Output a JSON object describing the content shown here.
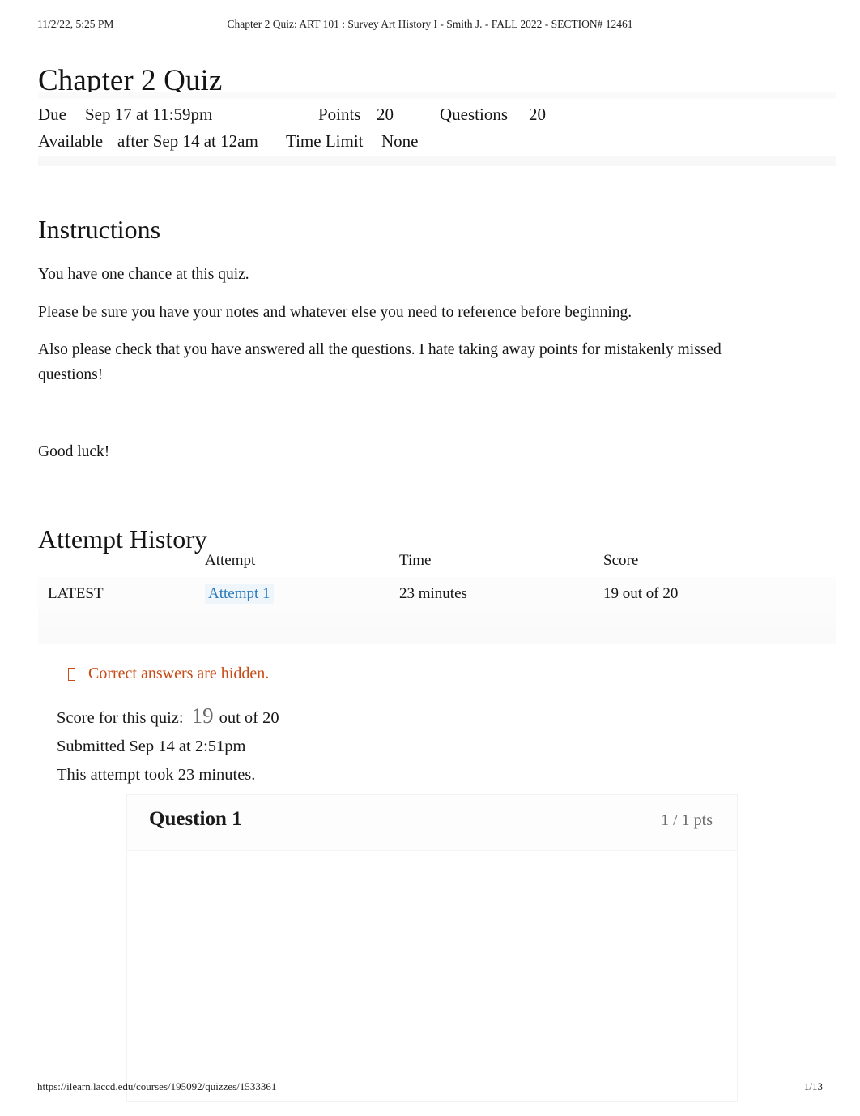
{
  "print_header": {
    "timestamp": "11/2/22, 5:25 PM",
    "document_title": "Chapter 2 Quiz: ART 101 : Survey Art History I - Smith J. - FALL 2022 - SECTION# 12461"
  },
  "page_title": "Chapter 2 Quiz",
  "quiz_meta": {
    "due_label": "Due",
    "due_value": "Sep 17 at 11:59pm",
    "points_label": "Points",
    "points_value": "20",
    "questions_label": "Questions",
    "questions_value": "20",
    "available_label": "Available",
    "available_value": "after Sep 14 at 12am",
    "time_limit_label": "Time Limit",
    "time_limit_value": "None"
  },
  "instructions": {
    "heading": "Instructions",
    "p1": "You have one chance at this quiz.",
    "p2": "Please be sure you have your notes and whatever else you need to reference before beginning.",
    "p3": "Also please check that you have answered all the questions. I hate taking away points for mistakenly missed questions!",
    "p4": "Good luck!"
  },
  "attempt_history": {
    "heading": "Attempt History",
    "columns": [
      "",
      "Attempt",
      "Time",
      "Score"
    ],
    "rows": [
      {
        "flag": "LATEST",
        "attempt": "Attempt 1",
        "time": "23 minutes",
        "score": "19 out of 20"
      }
    ]
  },
  "notice": {
    "icon": "tofu-missing-glyph-icon",
    "text": "Correct answers are hidden.",
    "color": "#c94b17"
  },
  "score_summary": {
    "label": "Score for this quiz:",
    "score": "19",
    "out_of": "out of 20",
    "submitted": "Submitted Sep 14 at 2:51pm",
    "duration": "This attempt took 23 minutes."
  },
  "question": {
    "title": "Question 1",
    "points": "1 / 1 pts"
  },
  "print_footer": {
    "url": "https://ilearn.laccd.edu/courses/195092/quizzes/1533361",
    "page": "1/13"
  },
  "colors": {
    "link": "#2b7abc",
    "notice": "#c94b17",
    "muted": "#6b6b6b"
  }
}
